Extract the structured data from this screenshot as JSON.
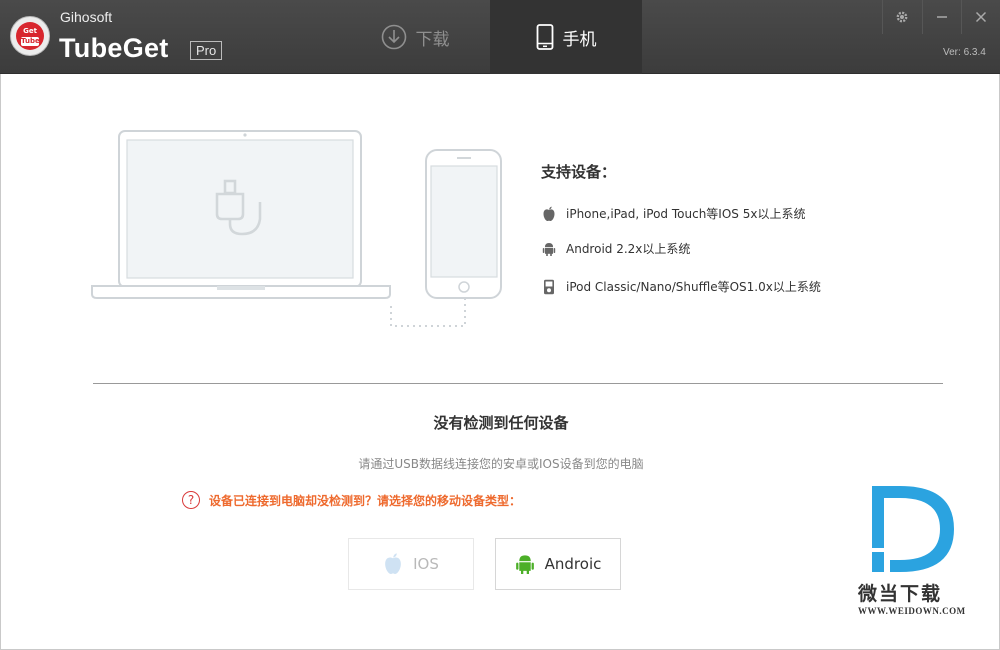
{
  "app": {
    "company": "Gihosoft",
    "name": "TubeGet",
    "edition": "Pro",
    "version": "Ver: 6.3.4"
  },
  "tabs": [
    {
      "label": "下载",
      "icon": "download-circle-icon",
      "active": false
    },
    {
      "label": "手机",
      "icon": "phone-icon",
      "active": true
    }
  ],
  "window_controls": [
    "gear-icon",
    "minimize-icon",
    "close-icon"
  ],
  "support": {
    "title": "支持设备：",
    "devices": [
      {
        "icon": "apple-icon",
        "text": "iPhone,iPad, iPod Touch等IOS 5x以上系统"
      },
      {
        "icon": "android-icon",
        "text": "Android 2.2x以上系统"
      },
      {
        "icon": "ipod-icon",
        "text": "iPod Classic/Nano/Shuffle等OS1.0x以上系统"
      }
    ]
  },
  "status": {
    "title": "没有检测到任何设备",
    "hint": "请通过USB数据线连接您的安卓或IOS设备到您的电脑",
    "warning_icon": "?",
    "warning": "设备已连接到电脑却没检测到？请选择您的移动设备类型："
  },
  "buttons": {
    "ios": "IOS",
    "android": "Androic"
  },
  "watermark": {
    "text": "微当下载",
    "url": "WWW.WEIDOWN.COM"
  },
  "colors": {
    "titlebar": "#404040",
    "warning": "#ee6a2e",
    "android_green": "#4caf28",
    "watermark_blue": "#2ba3e0"
  }
}
